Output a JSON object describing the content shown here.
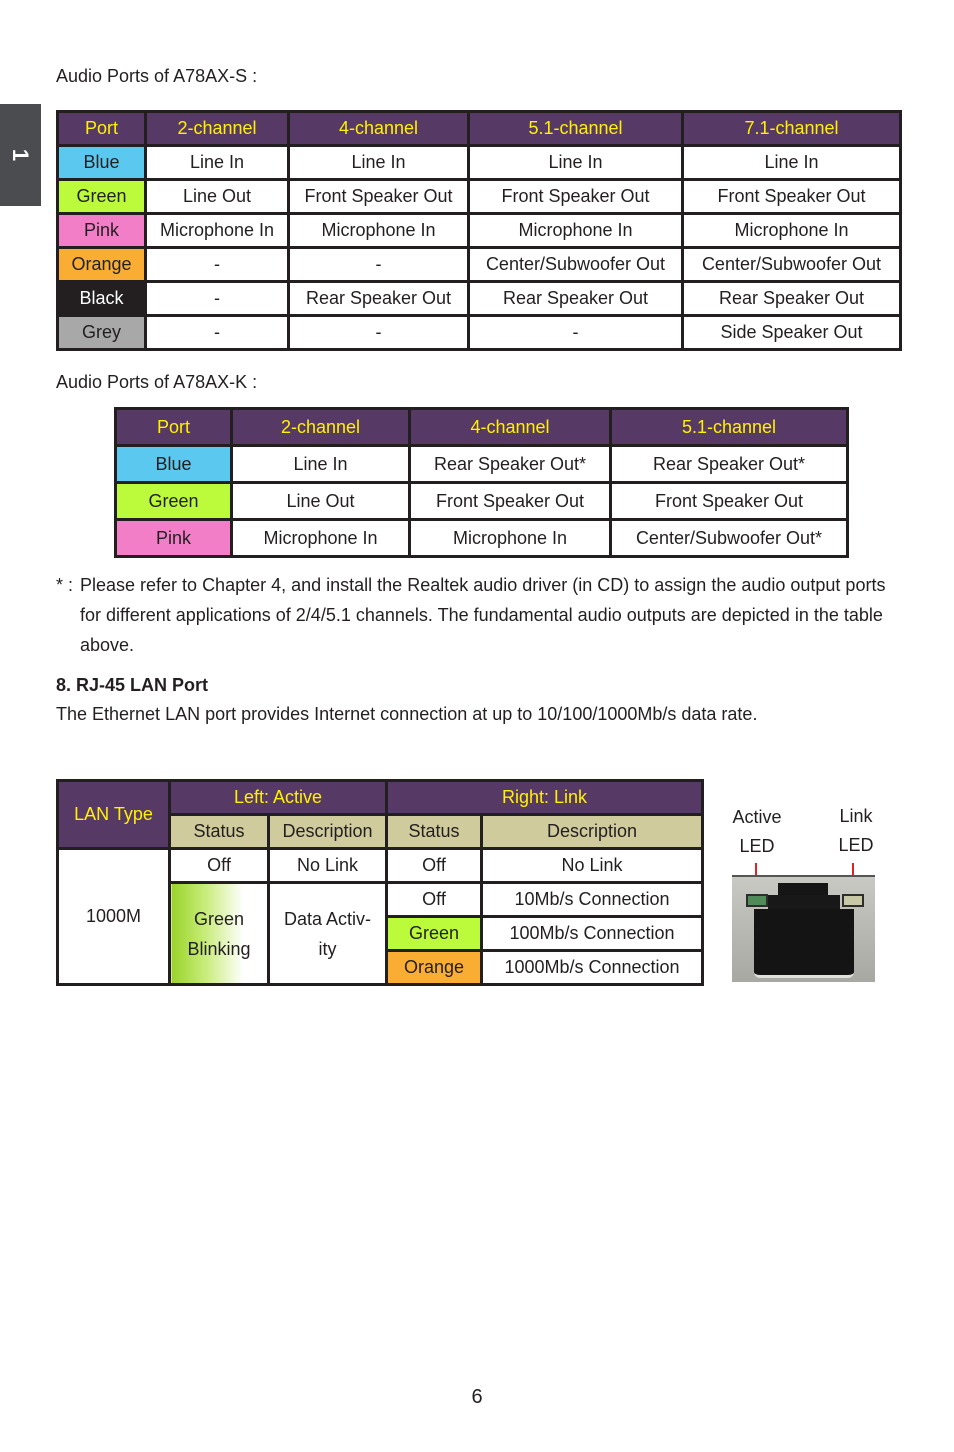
{
  "chapter_tab": "1",
  "table_s": {
    "caption": "Audio Ports of A78AX-S :",
    "headers": [
      "Port",
      "2-channel",
      "4-channel",
      "5.1-channel",
      "7.1-channel"
    ],
    "rows": [
      {
        "port": "Blue",
        "color": "#5bc8ef",
        "cells": [
          "Line In",
          "Line In",
          "Line In",
          "Line In"
        ]
      },
      {
        "port": "Green",
        "color": "#bbfb3c",
        "cells": [
          "Line Out",
          "Front Speaker Out",
          "Front Speaker Out",
          "Front Speaker Out"
        ]
      },
      {
        "port": "Pink",
        "color": "#f27ec8",
        "cells": [
          "Microphone In",
          "Microphone In",
          "Microphone In",
          "Microphone In"
        ]
      },
      {
        "port": "Orange",
        "color": "#f9ae33",
        "cells": [
          "-",
          "-",
          "Center/Subwoofer Out",
          "Center/Subwoofer Out"
        ]
      },
      {
        "port": "Black",
        "color": "#231f20",
        "cells": [
          "-",
          "Rear Speaker Out",
          "Rear Speaker Out",
          "Rear Speaker Out"
        ]
      },
      {
        "port": "Grey",
        "color": "#a8a8a8",
        "cells": [
          "-",
          "-",
          "-",
          "Side Speaker Out"
        ]
      }
    ]
  },
  "table_k": {
    "caption": "Audio Ports of A78AX-K :",
    "headers": [
      "Port",
      "2-channel",
      "4-channel",
      "5.1-channel"
    ],
    "rows": [
      {
        "port": "Blue",
        "color": "#5bc8ef",
        "cells": [
          "Line In",
          "Rear Speaker Out*",
          "Rear Speaker Out*"
        ]
      },
      {
        "port": "Green",
        "color": "#bbfb3c",
        "cells": [
          "Line Out",
          "Front Speaker Out",
          "Front Speaker Out"
        ]
      },
      {
        "port": "Pink",
        "color": "#f27ec8",
        "cells": [
          "Microphone In",
          "Microphone In",
          "Center/Subwoofer Out*"
        ]
      }
    ]
  },
  "footnote": {
    "marker": "* :",
    "text": "Please refer to Chapter 4, and install the Realtek audio driver (in CD) to assign the audio output ports for different applications of 2/4/5.1 channels. The fundamental audio outputs are depicted in the table above."
  },
  "section": {
    "title": "8. RJ-45 LAN Port",
    "body": "The Ethernet LAN port provides Internet connection at up to 10/100/1000Mb/s data rate."
  },
  "lan_table": {
    "lan_type_header": "LAN Type",
    "left_header": "Left: Active",
    "right_header": "Right: Link",
    "sub_headers": [
      "Status",
      "Description",
      "Status",
      "Description"
    ],
    "lan_type": "1000M",
    "left_rows": [
      {
        "status": "Off",
        "description": "No Link"
      },
      {
        "status": "Green Blinking",
        "description": "Data Activ- ity"
      }
    ],
    "right_rows": [
      {
        "status": "Off",
        "description": "No Link",
        "color": "#ffffff"
      },
      {
        "status": "Off",
        "description": "10Mb/s Connection",
        "color": "#ffffff"
      },
      {
        "status": "Green",
        "description": "100Mb/s Connection",
        "color": "#bbfb3c"
      },
      {
        "status": "Orange",
        "description": "1000Mb/s Connection",
        "color": "#f9ae33"
      }
    ]
  },
  "led_labels": {
    "active": [
      "Active",
      "LED"
    ],
    "link": [
      "Link",
      "LED"
    ]
  },
  "colors": {
    "header_bg": "#573966",
    "header_text": "#fff200",
    "subheader_bg": "#cfcb9c",
    "arrow": "#e0202a"
  },
  "page_number": "6"
}
